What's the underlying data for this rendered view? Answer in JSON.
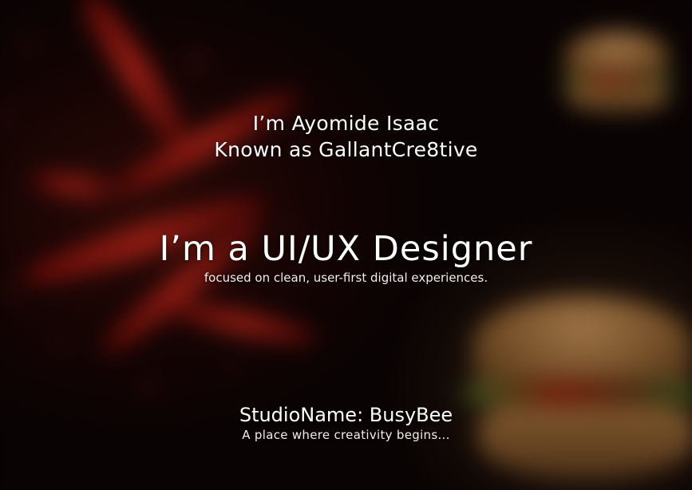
{
  "hero": {
    "intro_line_1": "I’m Ayomide Isaac",
    "intro_line_2": "Known as GallantCre8tive",
    "headline": "I’m a UI/UX Designer",
    "tagline": "focused on clean, user-first digital experiences.",
    "studio_name": "StudioName: BusyBee",
    "studio_tagline": "A place where creativity begins..."
  },
  "colors": {
    "background": "#0a0303",
    "text": "#ffffff",
    "chili_red": "#c3261a",
    "bun_brown": "#9c6a34"
  }
}
